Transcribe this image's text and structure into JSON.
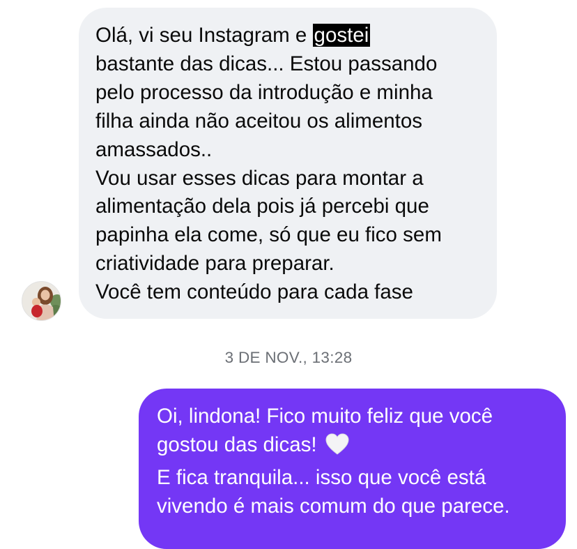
{
  "conversation": {
    "incoming": {
      "line1_before": "Olá, vi seu Instagram e ",
      "line1_highlight": "gostei",
      "lines": [
        "bastante das dicas... Estou passando",
        "pelo processo da introdução e minha",
        "filha ainda não aceitou os alimentos",
        "amassados..",
        "Vou usar esses dicas para montar a",
        "alimentação dela pois já percebi que",
        "papinha ela come, só que eu fico sem",
        "criatividade para preparar.",
        "Você tem conteúdo para cada fase"
      ]
    },
    "timestamp": "3 DE NOV., 13:28",
    "outgoing": {
      "line1": "Oi, lindona! Fico muito feliz que você",
      "line2_text": "gostou das dicas! ",
      "line2_icon": "white-heart-icon",
      "line3": "E fica tranquila... isso que você está",
      "line4": "vivendo é mais comum do que parece."
    }
  },
  "colors": {
    "incoming_bubble": "#eff1f4",
    "outgoing_bubble": "#7437f5",
    "highlight_bg": "#000000",
    "timestamp_text": "#6b6f75"
  }
}
